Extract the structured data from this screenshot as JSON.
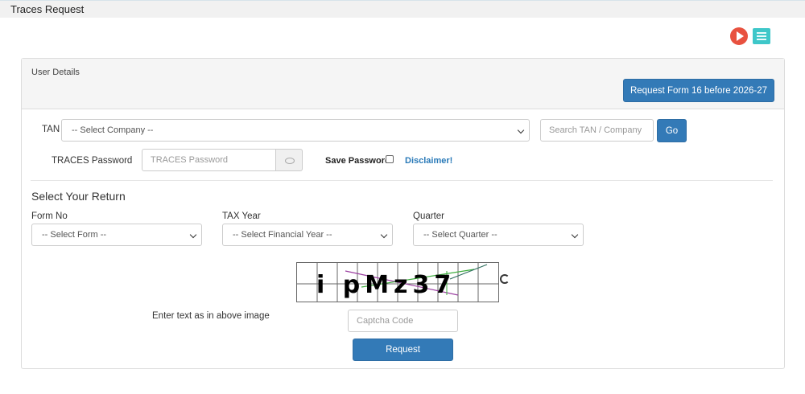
{
  "header": {
    "title": "Traces Request"
  },
  "icons": {
    "play": "play-icon",
    "list": "list-icon",
    "eye": "eye-icon",
    "refresh": "refresh-icon"
  },
  "card": {
    "label": "User Details",
    "request_form16_label": "Request Form 16 before 2026-27"
  },
  "tan": {
    "label": "TAN",
    "company_select_value": "-- Select Company --",
    "search_placeholder": "Search TAN / Company",
    "go_label": "Go"
  },
  "password": {
    "label": "TRACES Password",
    "placeholder": "TRACES Password",
    "save_label": "Save Password",
    "disclaimer": "Disclaimer!"
  },
  "return": {
    "section_title": "Select Your Return",
    "form_no_label": "Form No",
    "form_no_value": "-- Select Form --",
    "tax_year_label": "TAX Year",
    "tax_year_value": "-- Select Financial Year --",
    "quarter_label": "Quarter",
    "quarter_value": "-- Select Quarter --"
  },
  "captcha": {
    "text": "i pMz37",
    "instruction": "Enter text as in above image",
    "placeholder": "Captcha Code"
  },
  "actions": {
    "request_label": "Request"
  },
  "colors": {
    "primary": "#337ab7",
    "play": "#e8513f",
    "list": "#3ec7c9",
    "link": "#2a7ab8"
  }
}
